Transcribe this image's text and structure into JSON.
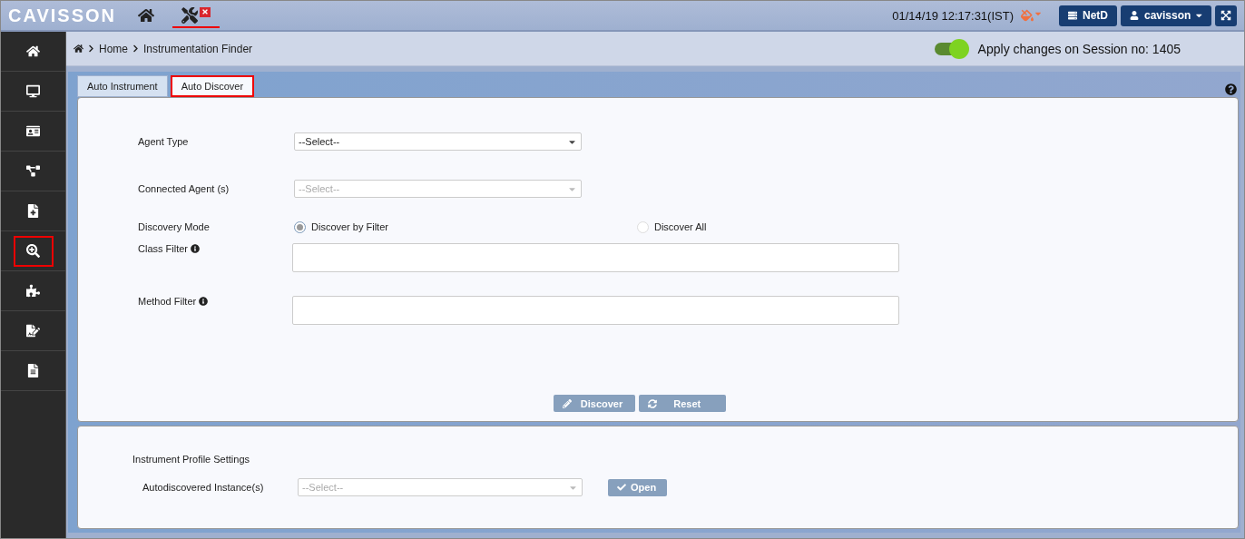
{
  "header": {
    "logo": "CAVISSON",
    "nav_tabs": [
      {
        "kind": "home",
        "selected": false,
        "closable": false
      },
      {
        "kind": "tools",
        "selected": true,
        "closable": true
      }
    ],
    "datetime": "01/14/19 12:17:31(IST)",
    "buttons": [
      {
        "kind": "server",
        "label": "NetD"
      },
      {
        "kind": "user",
        "label": "cavisson"
      }
    ]
  },
  "sidebar": {
    "items": [
      {
        "kind": "home",
        "selected": false
      },
      {
        "kind": "monitor",
        "selected": false
      },
      {
        "kind": "id-card",
        "selected": false
      },
      {
        "kind": "network",
        "selected": false
      },
      {
        "kind": "report",
        "selected": false
      },
      {
        "kind": "search",
        "selected": true
      },
      {
        "kind": "puzzle",
        "selected": false
      },
      {
        "kind": "document",
        "selected": false
      },
      {
        "kind": "doc-search",
        "selected": false
      }
    ]
  },
  "breadcrumb": [
    "Home",
    "Instrumentation Finder"
  ],
  "session_toggle": {
    "on": true,
    "label": "Apply changes on Session no: 1405"
  },
  "tabs": [
    {
      "label": "Auto Instrument",
      "selected": false
    },
    {
      "label": "Auto Discover",
      "selected": true
    }
  ],
  "discover_form": {
    "fields": [
      {
        "kind": "select",
        "label": "Agent Type",
        "value": "--Select--",
        "disabled": false
      },
      {
        "kind": "select",
        "label": "Connected Agent (s)",
        "value": "--Select--",
        "disabled": true
      },
      {
        "kind": "radio",
        "label": "Discovery Mode",
        "options": [
          {
            "label": "Discover by Filter",
            "selected": true
          },
          {
            "label": "Discover All",
            "selected": false
          }
        ]
      },
      {
        "kind": "text",
        "label": "Class Filter",
        "info": true
      },
      {
        "kind": "text",
        "label": "Method Filter",
        "info": true
      }
    ],
    "buttons": [
      {
        "kind": "edit",
        "label": "Discover"
      },
      {
        "kind": "refresh",
        "label": "Reset"
      }
    ]
  },
  "profile_settings": {
    "title": "Instrument Profile Settings",
    "field": {
      "label": "Autodiscovered Instance(s)",
      "value": "--Select--",
      "disabled": true
    },
    "button": {
      "kind": "check",
      "label": "Open"
    }
  }
}
